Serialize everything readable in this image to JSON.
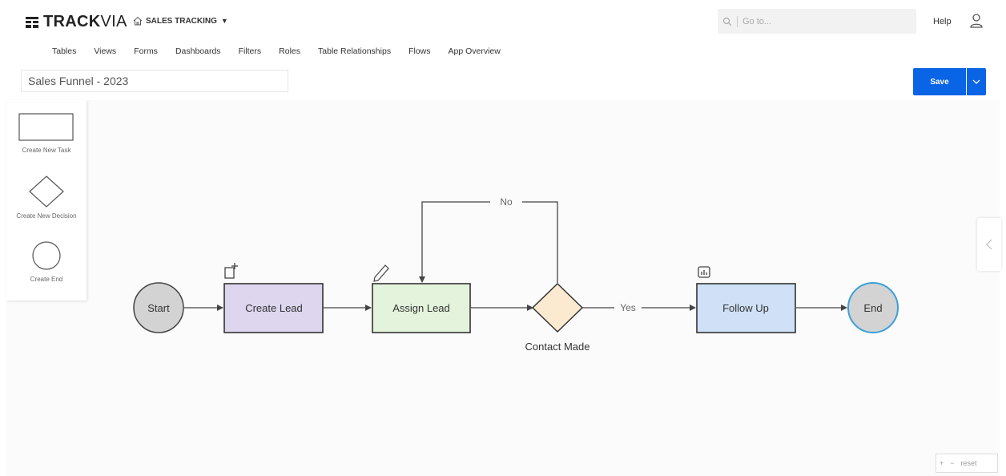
{
  "header": {
    "logo_bold": "TRACK",
    "logo_thin": "VIA",
    "app_name": "SALES TRACKING",
    "search_placeholder": "Go to...",
    "help_label": "Help"
  },
  "nav": {
    "tables": "Tables",
    "views": "Views",
    "forms": "Forms",
    "dashboards": "Dashboards",
    "filters": "Filters",
    "roles": "Roles",
    "table_relationships": "Table Relationships",
    "flows": "Flows",
    "app_overview": "App Overview"
  },
  "flow": {
    "name": "Sales Funnel - 2023",
    "save_label": "Save"
  },
  "palette": {
    "task_label": "Create New Task",
    "decision_label": "Create New Decision",
    "end_label": "Create End"
  },
  "diagram": {
    "start": "Start",
    "create_lead": "Create Lead",
    "assign_lead": "Assign Lead",
    "decision": "Contact Made",
    "follow_up": "Follow Up",
    "end": "End",
    "edge_no": "No",
    "edge_yes": "Yes"
  },
  "zoom": {
    "plus": "+",
    "minus": "−",
    "reset": "reset"
  },
  "colors": {
    "primary": "#0a64e6",
    "create_lead_fill": "#ddd6ee",
    "assign_lead_fill": "#e4f3dc",
    "decision_fill": "#fbead0",
    "follow_up_fill": "#cfe0f7",
    "terminal_fill": "#d3d3d3",
    "end_border": "#3aa0d8"
  },
  "icons": {
    "logo": "grid-logo-icon",
    "home": "home-icon",
    "search": "search-icon",
    "user": "user-icon",
    "create_lead": "add-record-icon",
    "assign_lead": "pencil-edit-icon",
    "follow_up": "chart-icon"
  }
}
